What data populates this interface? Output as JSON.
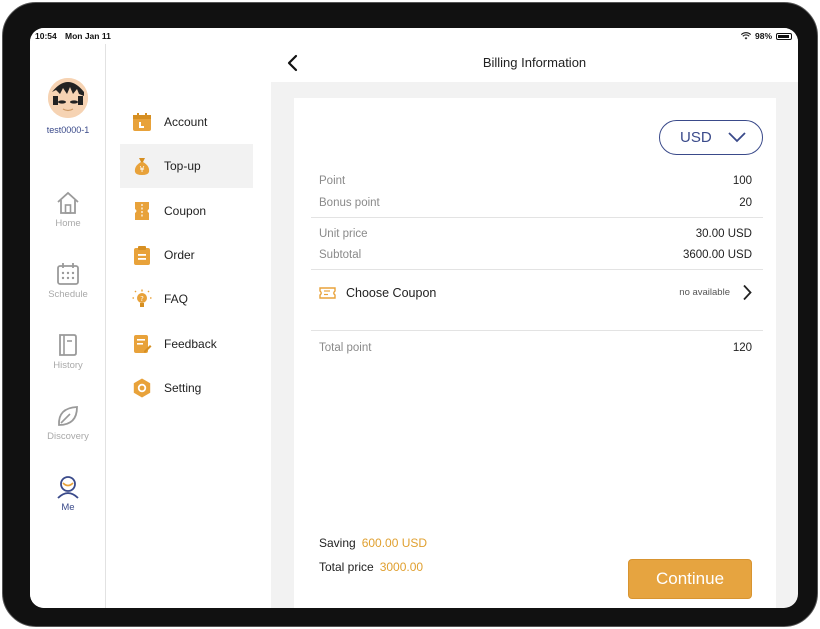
{
  "status_bar": {
    "time": "10:54",
    "date": "Mon Jan 11",
    "battery": "98%"
  },
  "user": {
    "username": "test0000-1"
  },
  "nav": {
    "items": [
      {
        "label": "Home",
        "icon": "home-icon"
      },
      {
        "label": "Schedule",
        "icon": "calendar-icon"
      },
      {
        "label": "History",
        "icon": "book-icon"
      },
      {
        "label": "Discovery",
        "icon": "leaf-icon"
      },
      {
        "label": "Me",
        "icon": "user-icon",
        "active": true
      }
    ]
  },
  "menu": {
    "items": [
      {
        "label": "Account",
        "icon": "calendar-icon"
      },
      {
        "label": "Top-up",
        "icon": "money-bag-icon",
        "active": true
      },
      {
        "label": "Coupon",
        "icon": "coupon-icon"
      },
      {
        "label": "Order",
        "icon": "clipboard-icon"
      },
      {
        "label": "FAQ",
        "icon": "lightbulb-icon"
      },
      {
        "label": "Feedback",
        "icon": "feedback-icon"
      },
      {
        "label": "Setting",
        "icon": "gear-icon"
      }
    ]
  },
  "header": {
    "title": "Billing Information"
  },
  "billing": {
    "currency": "USD",
    "point_label": "Point",
    "point_value": "100",
    "bonus_label": "Bonus point",
    "bonus_value": "20",
    "unit_price_label": "Unit price",
    "unit_price_value": "30.00 USD",
    "subtotal_label": "Subtotal",
    "subtotal_value": "3600.00 USD",
    "coupon_label": "Choose Coupon",
    "coupon_status": "no available",
    "total_point_label": "Total point",
    "total_point_value": "120",
    "saving_label": "Saving",
    "saving_value": "600.00 USD",
    "total_price_label": "Total price",
    "total_price_value": "3000.00",
    "continue_label": "Continue"
  },
  "colors": {
    "accent": "#e6a440",
    "navy": "#3a4a8a",
    "icon_orange": "#e8a23a"
  }
}
